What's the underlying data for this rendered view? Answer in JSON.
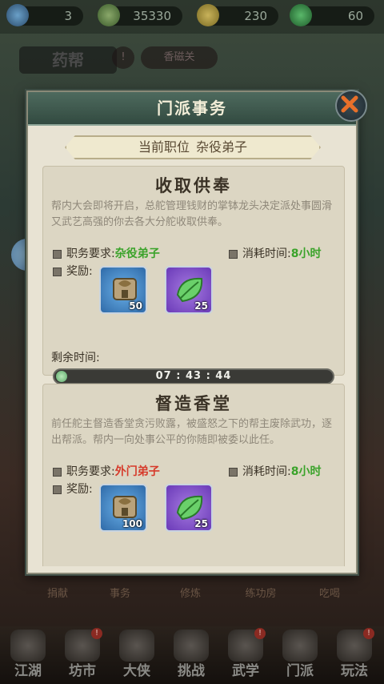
{
  "top_resources": [
    {
      "icon": "energy-icon",
      "value": "3"
    },
    {
      "icon": "coin-bag-icon",
      "value": "35330"
    },
    {
      "icon": "gold-coin-icon",
      "value": "230"
    },
    {
      "icon": "jade-icon",
      "value": "60"
    }
  ],
  "background": {
    "guild_name": "药帮",
    "chip_text": "香磁关",
    "activities": [
      "捐献",
      "事务",
      "修炼",
      "练功房",
      "吃喝"
    ]
  },
  "dialog": {
    "title": "门派事务",
    "rank_label": "当前职位",
    "rank_value": "杂役弟子"
  },
  "tasks": [
    {
      "title": "收取供奉",
      "description": "帮内大会即将开启，总舵管理钱财的掌钵龙头决定派处事圆滑又武艺高强的你去各大分舵收取供奉。",
      "req_label": "职务要求:",
      "req_value": "杂役弟子",
      "time_label": "消耗时间:",
      "time_value": "8小时",
      "reward_label": "奖励:",
      "rewards": [
        {
          "icon": "token-plaque-icon",
          "qty": "50"
        },
        {
          "icon": "green-leaf-icon",
          "qty": "25"
        }
      ],
      "remaining_label": "剩余时间:",
      "remaining_value": "07 : 43 : 44",
      "progress": 0.03
    },
    {
      "title": "督造香堂",
      "description": "前任舵主督造香堂贪污败露，被盛怒之下的帮主废除武功，逐出帮派。帮内一向处事公平的你随即被委以此任。",
      "req_label": "职务要求:",
      "req_value": "外门弟子",
      "time_label": "消耗时间:",
      "time_value": "8小时",
      "reward_label": "奖励:",
      "rewards": [
        {
          "icon": "token-plaque-icon",
          "qty": "100"
        },
        {
          "icon": "green-leaf-icon",
          "qty": "25"
        }
      ]
    }
  ],
  "bottom_nav": [
    {
      "label": "江湖",
      "badge": ""
    },
    {
      "label": "坊市",
      "badge": "!"
    },
    {
      "label": "大侠",
      "badge": ""
    },
    {
      "label": "挑战",
      "badge": ""
    },
    {
      "label": "武学",
      "badge": "!"
    },
    {
      "label": "门派",
      "badge": ""
    },
    {
      "label": "玩法",
      "badge": "!"
    }
  ],
  "colors": {
    "accent_green": "#3aa32a",
    "accent_red": "#d63a2a",
    "header": "#3e5a4e"
  }
}
